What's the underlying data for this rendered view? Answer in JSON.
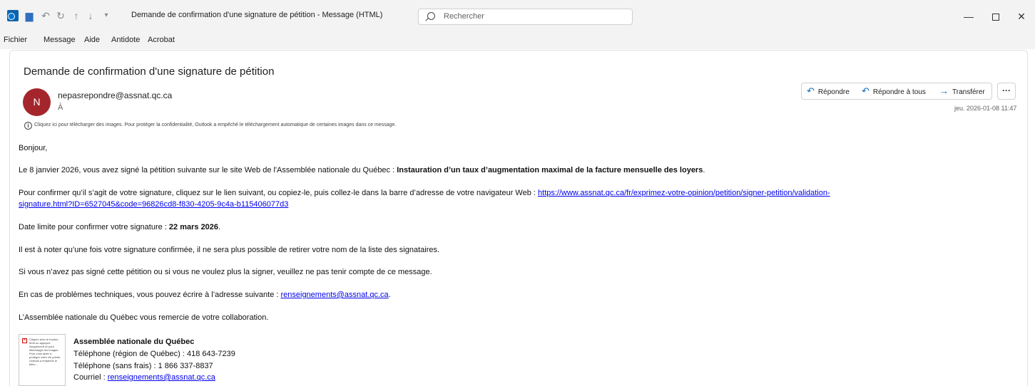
{
  "titlebar": {
    "title": "Demande de confirmation d'une signature de pétition  -  Message (HTML)",
    "search_placeholder": "Rechercher",
    "icons": [
      "outlook-icon",
      "save-icon",
      "undo-icon",
      "redo-icon",
      "up-icon",
      "down-icon",
      "quick-access-icon"
    ],
    "minimize": "—",
    "close": "✕"
  },
  "menu": {
    "items": [
      "Fichier",
      "Message",
      "Aide",
      "Antidote",
      "Acrobat"
    ]
  },
  "message": {
    "subject": "Demande de confirmation d'une signature de pétition",
    "avatar_initial": "N",
    "avatar_color": "#a4262c",
    "sender": "nepasrepondre@assnat.qc.ca",
    "to_label": "À",
    "date": "jeu. 2026-01-08 11:47",
    "actions": {
      "reply": "Répondre",
      "reply_all": "Répondre à tous",
      "forward": "Transférer",
      "more": "···"
    },
    "infobar": "Cliquez ici pour télécharger des images. Pour protéger la confidentialité, Outlook a empêché le téléchargement automatique de certaines images dans ce message."
  },
  "body": {
    "greeting": "Bonjour,",
    "p1_prefix": "Le 8 janvier 2026, vous avez signé la pétition suivante sur le site Web de l'Assemblée nationale du Québec : ",
    "p1_bold": "Instauration d’un taux d’augmentation maximal de la facture mensuelle des loyers",
    "p1_suffix": ".",
    "p2_prefix": "Pour confirmer qu’il s’agit de votre signature, cliquez sur le lien suivant, ou copiez-le, puis collez-le dans la barre d’adresse de votre navigateur Web : ",
    "p2_link_part1": "https://www.assnat.qc.ca/fr/exprimez-votre-opinion/petition/signer-petition/validation-",
    "p2_link_part2": "signature.html?ID=6527045&code=96826cd8-f830-4205-9c4a-b115406077d3",
    "p3_prefix": "Date limite pour confirmer votre signature : ",
    "p3_bold": "22 mars 2026",
    "p3_suffix": ".",
    "p4": "Il est à noter qu’une fois votre signature confirmée, il ne sera plus possible de retirer votre nom de la liste des signataires.",
    "p5": "Si vous n’avez pas signé cette pétition ou si vous ne voulez plus la signer, veuillez ne pas tenir compte de ce message.",
    "p6_prefix": "En cas de problèmes techniques, vous pouvez écrire à l’adresse suivante : ",
    "p6_link": "renseignements@assnat.qc.ca",
    "p6_suffix": ".",
    "p7": "L’Assemblée nationale du Québec vous remercie de votre collaboration."
  },
  "signature": {
    "image_placeholder_text": "Cliquez avec le bouton droit ou appuyez longuement ici pour télécharger les images. Pour vous aider à protéger votre vie privée, Outlook a empêché le téléc…",
    "name": "Assemblée nationale du Québec",
    "phone_local": "Téléphone (région de Québec) : 418 643-7239",
    "phone_free": "Téléphone (sans frais) : 1 866 337-8837",
    "email_label": "Courriel : ",
    "email_link": "renseignements@assnat.qc.ca"
  }
}
